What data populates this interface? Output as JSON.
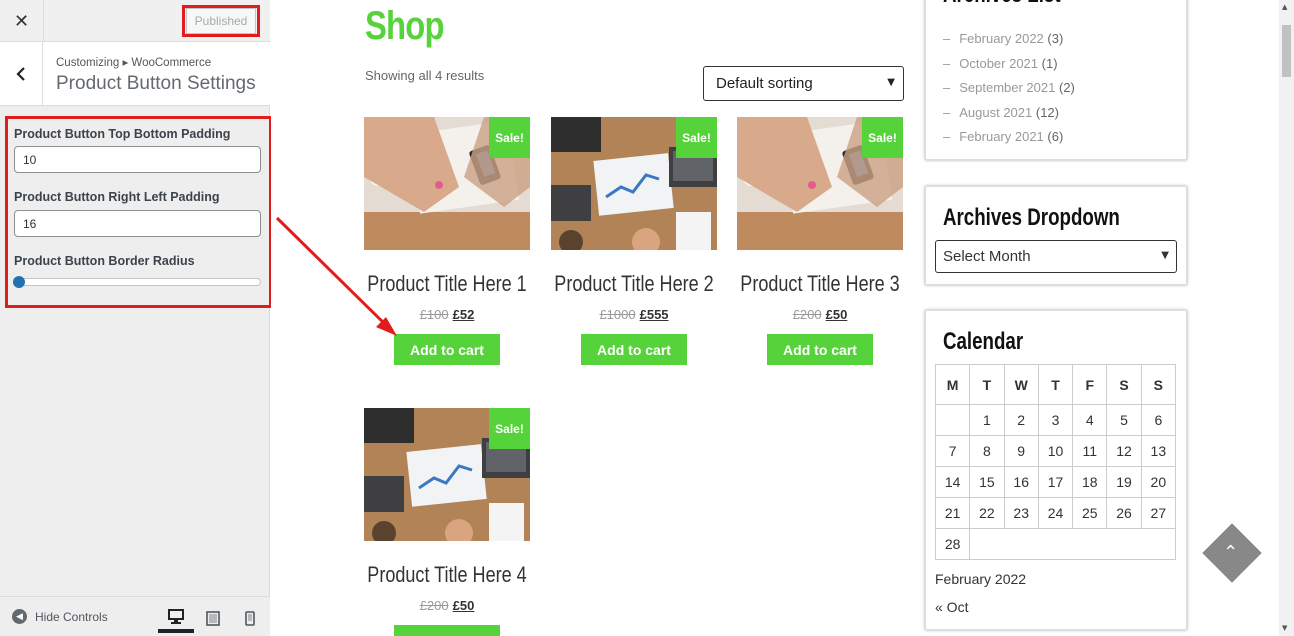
{
  "customizer": {
    "close_glyph": "✕",
    "publish_label": "Published",
    "back_glyph": "‹",
    "breadcrumb": "Customizing ▸ WooCommerce",
    "panel_title": "Product Button Settings",
    "controls": {
      "top_bottom_padding": {
        "label": "Product Button Top Bottom Padding",
        "value": "10"
      },
      "right_left_padding": {
        "label": "Product Button Right Left Padding",
        "value": "16"
      },
      "border_radius": {
        "label": "Product Button Border Radius",
        "value_fraction": 0
      }
    },
    "footer": {
      "hide_controls_label": "Hide Controls",
      "devices": [
        "desktop-icon",
        "tablet-icon",
        "mobile-icon"
      ],
      "active_device": "desktop"
    }
  },
  "shop": {
    "title": "Shop",
    "result_count": "Showing all 4 results",
    "sorting": "Default sorting",
    "sale_badge": "Sale!",
    "cart_label": "Add to cart",
    "products": [
      {
        "title": "Product Title Here 1",
        "old_price": "£100",
        "price": "£52"
      },
      {
        "title": "Product Title Here 2",
        "old_price": "£1000",
        "price": "£555"
      },
      {
        "title": "Product Title Here 3",
        "old_price": "£200",
        "price": "£50"
      },
      {
        "title": "Product Title Here 4",
        "old_price": "£200",
        "price": "£50"
      }
    ]
  },
  "widgets": {
    "archives_list": {
      "title": "Archives List",
      "items": [
        {
          "label": "February 2022",
          "count": "(3)"
        },
        {
          "label": "October 2021",
          "count": "(1)"
        },
        {
          "label": "September 2021",
          "count": "(2)"
        },
        {
          "label": "August 2021",
          "count": "(12)"
        },
        {
          "label": "February 2021",
          "count": "(6)"
        }
      ]
    },
    "archives_dropdown": {
      "title": "Archives Dropdown",
      "selected": "Select Month"
    },
    "calendar": {
      "title": "Calendar",
      "weekdays": [
        "M",
        "T",
        "W",
        "T",
        "F",
        "S",
        "S"
      ],
      "weeks": [
        [
          "",
          "1",
          "2",
          "3",
          "4",
          "5",
          "6"
        ],
        [
          "7",
          "8",
          "9",
          "10",
          "11",
          "12",
          "13"
        ],
        [
          "14",
          "15",
          "16",
          "17",
          "18",
          "19",
          "20"
        ],
        [
          "21",
          "22",
          "23",
          "24",
          "25",
          "26",
          "27"
        ],
        [
          "28"
        ]
      ],
      "caption": "February 2022",
      "prev_link": "« Oct"
    }
  },
  "colors": {
    "accent_green": "#56d33a",
    "highlight_red": "#e21c1c"
  }
}
